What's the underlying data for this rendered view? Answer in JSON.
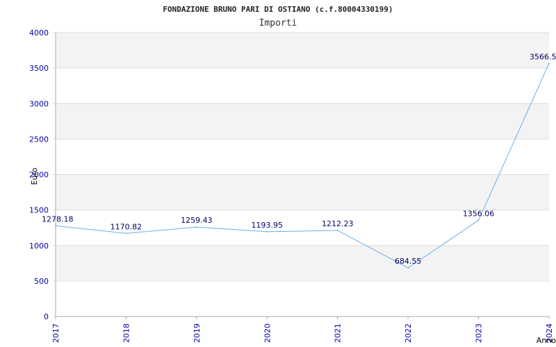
{
  "chart_data": {
    "type": "line",
    "title": "FONDAZIONE BRUNO PARI DI OSTIANO (c.f.80004330199)",
    "subtitle": "Importi",
    "xlabel": "Anno",
    "ylabel": "Euro",
    "categories": [
      "2017",
      "2018",
      "2019",
      "2020",
      "2021",
      "2022",
      "2023",
      "2024"
    ],
    "series": [
      {
        "values": [
          1278.18,
          1170.82,
          1259.43,
          1193.95,
          1212.23,
          684.55,
          1356.06,
          3566.5
        ],
        "labels": [
          "1278.18",
          "1170.82",
          "1259.43",
          "1193.95",
          "1212.23",
          "684.55",
          "1356.06",
          "3566.5"
        ],
        "color": "#6aaeea"
      }
    ],
    "ylim": [
      0,
      4000
    ],
    "yticks": [
      "0",
      "500",
      "1000",
      "1500",
      "2000",
      "2500",
      "3000",
      "3500",
      "4000"
    ],
    "grid": true,
    "band_colors": [
      "#f3f3f3",
      "#ffffff"
    ],
    "axis_color": "#aaaaaa"
  }
}
